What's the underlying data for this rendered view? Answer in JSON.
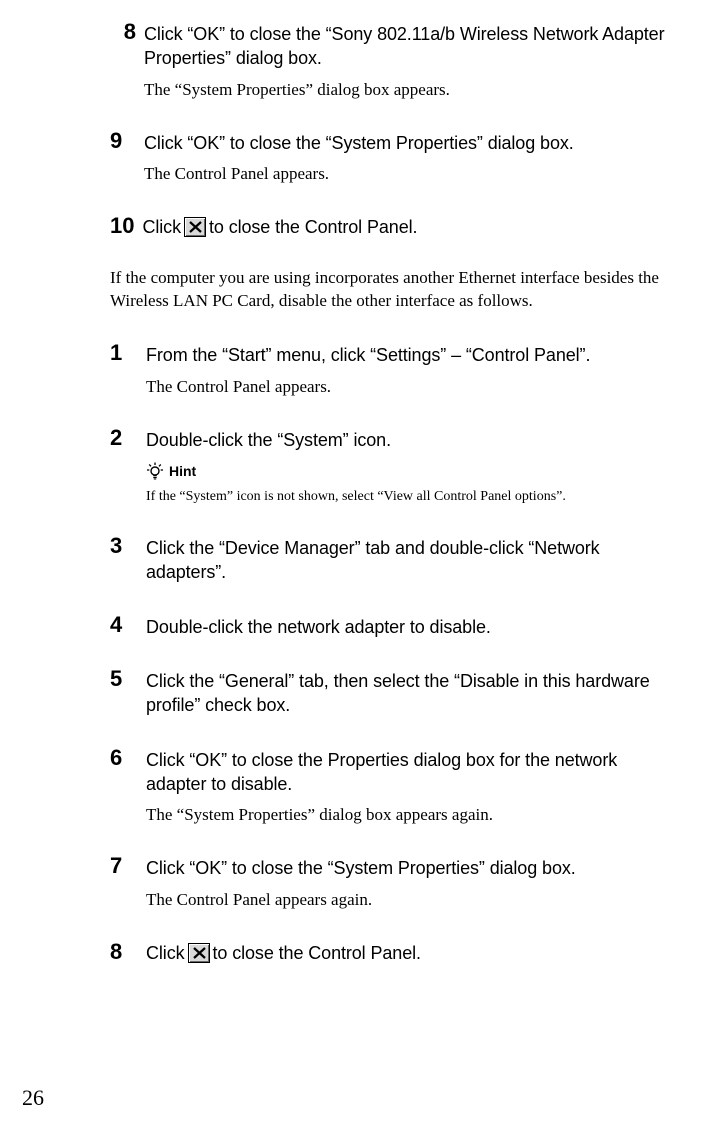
{
  "listA": {
    "step8": {
      "num": "8",
      "main": "Click “OK” to close the “Sony 802.11a/b Wireless Network Adapter Properties” dialog box.",
      "sub": "The “System Properties” dialog box appears."
    },
    "step9": {
      "num": "9",
      "main": "Click “OK” to close the “System Properties” dialog box.",
      "sub": "The Control Panel appears."
    },
    "step10": {
      "num": "10",
      "mainBefore": "Click ",
      "mainAfter": " to close the Control Panel."
    }
  },
  "midPara": "If the computer you are using incorporates another Ethernet interface besides the Wireless LAN PC Card, disable the other interface as follows.",
  "listB": {
    "step1": {
      "num": "1",
      "main": "From the “Start” menu, click “Settings” – “Control Panel”.",
      "sub": "The Control Panel appears."
    },
    "step2": {
      "num": "2",
      "main": "Double-click the “System” icon.",
      "hintLabel": "Hint",
      "hintText": "If the “System” icon is not shown, select “View all Control Panel options”."
    },
    "step3": {
      "num": "3",
      "main": "Click the “Device Manager” tab and double-click “Network adapters”."
    },
    "step4": {
      "num": "4",
      "main": "Double-click the network adapter to disable."
    },
    "step5": {
      "num": "5",
      "main": "Click the “General” tab, then select the “Disable in this hardware profile” check box."
    },
    "step6": {
      "num": "6",
      "main": "Click “OK” to close the Properties dialog box for the network adapter to disable.",
      "sub": "The “System Properties” dialog box appears again."
    },
    "step7": {
      "num": "7",
      "main": "Click “OK” to close the “System Properties” dialog box.",
      "sub": "The Control Panel appears again."
    },
    "step8b": {
      "num": "8",
      "mainBefore": "Click ",
      "mainAfter": " to close the Control Panel."
    }
  },
  "pageNumber": "26"
}
